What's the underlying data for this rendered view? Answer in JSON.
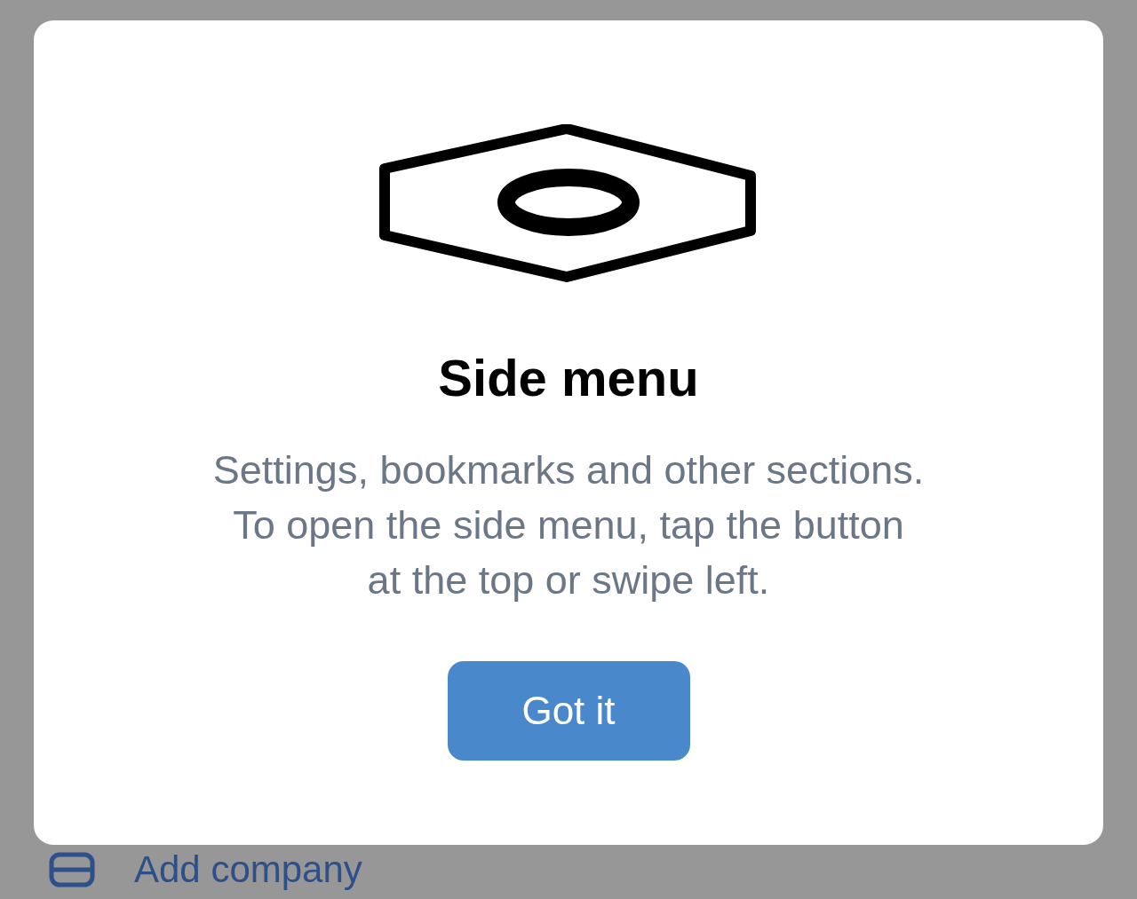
{
  "dialog": {
    "title": "Side menu",
    "body": [
      "Settings, bookmarks and other sections.",
      "To open the side menu, tap the button",
      "at the top or swipe left."
    ],
    "button": "Got it"
  },
  "background": {
    "item": "Add company"
  }
}
